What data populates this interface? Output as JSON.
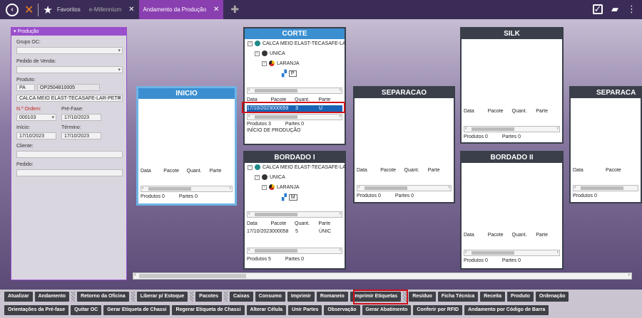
{
  "topbar": {
    "tabs": [
      {
        "label": "Favoritos"
      },
      {
        "label": "e-Millennium"
      },
      {
        "label": "Andamento da Produção"
      }
    ]
  },
  "filter": {
    "title": "Produção",
    "grupo_oc_label": "Grupo OC:",
    "pedido_venda_label": "Pedido de Venda:",
    "produto_label": "Produto:",
    "produto_prefix": "PA",
    "produto_code": "OP2504810005",
    "produto_desc": "CALCA MEIO ELAST-TECASAFE-LAR-PETR",
    "ordem_label": "N.º Ordem:",
    "ordem_value": "000103",
    "prefase_label": "Pré-Fase:",
    "prefase_value": "17/10/2023",
    "inicio_label": "Início:",
    "inicio_value": "17/10/2023",
    "termino_label": "Término:",
    "termino_value": "17/10/2023",
    "cliente_label": "Cliente:",
    "pedido_label": "Pedido:"
  },
  "columns": {
    "data": "Data",
    "pacote": "Pacote",
    "quant": "Quant.",
    "parte": "Parte"
  },
  "footer": {
    "produtos": "Produtos",
    "partes": "Partes"
  },
  "stages": {
    "inicio": {
      "title": "INICIO",
      "produtos": "0",
      "partes": "0"
    },
    "corte": {
      "title": "CORTE",
      "tree_product": "CALCA MEIO ELAST-TECASAFE-LA",
      "tree_group": "UNICA",
      "tree_color": "LARANJA",
      "tree_size": "P",
      "row": {
        "data": "17/10/2023",
        "pacote": "000059",
        "quant": "3",
        "parte": "U"
      },
      "produtos": "3",
      "partes": "0",
      "note": "INÍCIO DE PRODUÇÃO"
    },
    "separacao": {
      "title": "SEPARACAO",
      "produtos": "0",
      "partes": "0"
    },
    "silk": {
      "title": "SILK",
      "produtos": "0",
      "partes": "0"
    },
    "separaca2": {
      "title": "SEPARACA",
      "produtos": "0",
      "partes": "0"
    },
    "bordado1": {
      "title": "BORDADO I",
      "tree_product": "CALCA MEIO ELAST-TECASAFE-LA",
      "tree_group": "UNICA",
      "tree_color": "LARANJA",
      "tree_size": "M",
      "row": {
        "data": "17/10/2023",
        "pacote": "000058",
        "quant": "5",
        "parte": "ÚNIC"
      },
      "produtos": "5",
      "partes": "0"
    },
    "bordado2": {
      "title": "BORDADO II",
      "produtos": "0",
      "partes": "0"
    }
  },
  "toolbar": {
    "row1": [
      "Atualizar",
      "Andamento",
      "Retorno da Oficina",
      "Liberar p/ Estoque",
      "Pacotes",
      "Caixas",
      "Consumo",
      "Imprimir",
      "Romaneio",
      "Imprimir Etiquetas",
      "Resíduo",
      "Ficha Técnica",
      "Receita",
      "Produto",
      "Ordenação"
    ],
    "row2": [
      "Orientações da Pré-fase",
      "Quitar OC",
      "Gerar Etiqueta de Chassi",
      "Regerar Etiqueta de Chassi",
      "Alterar Célula",
      "Unir Partes",
      "Observação",
      "Gerar Abatimento",
      "Conferir por RFID",
      "Andamento por Código de Barra"
    ]
  },
  "colors": {
    "accent": "#8a3fb0",
    "highlight": "#d0101a",
    "selection": "#1863b5"
  }
}
